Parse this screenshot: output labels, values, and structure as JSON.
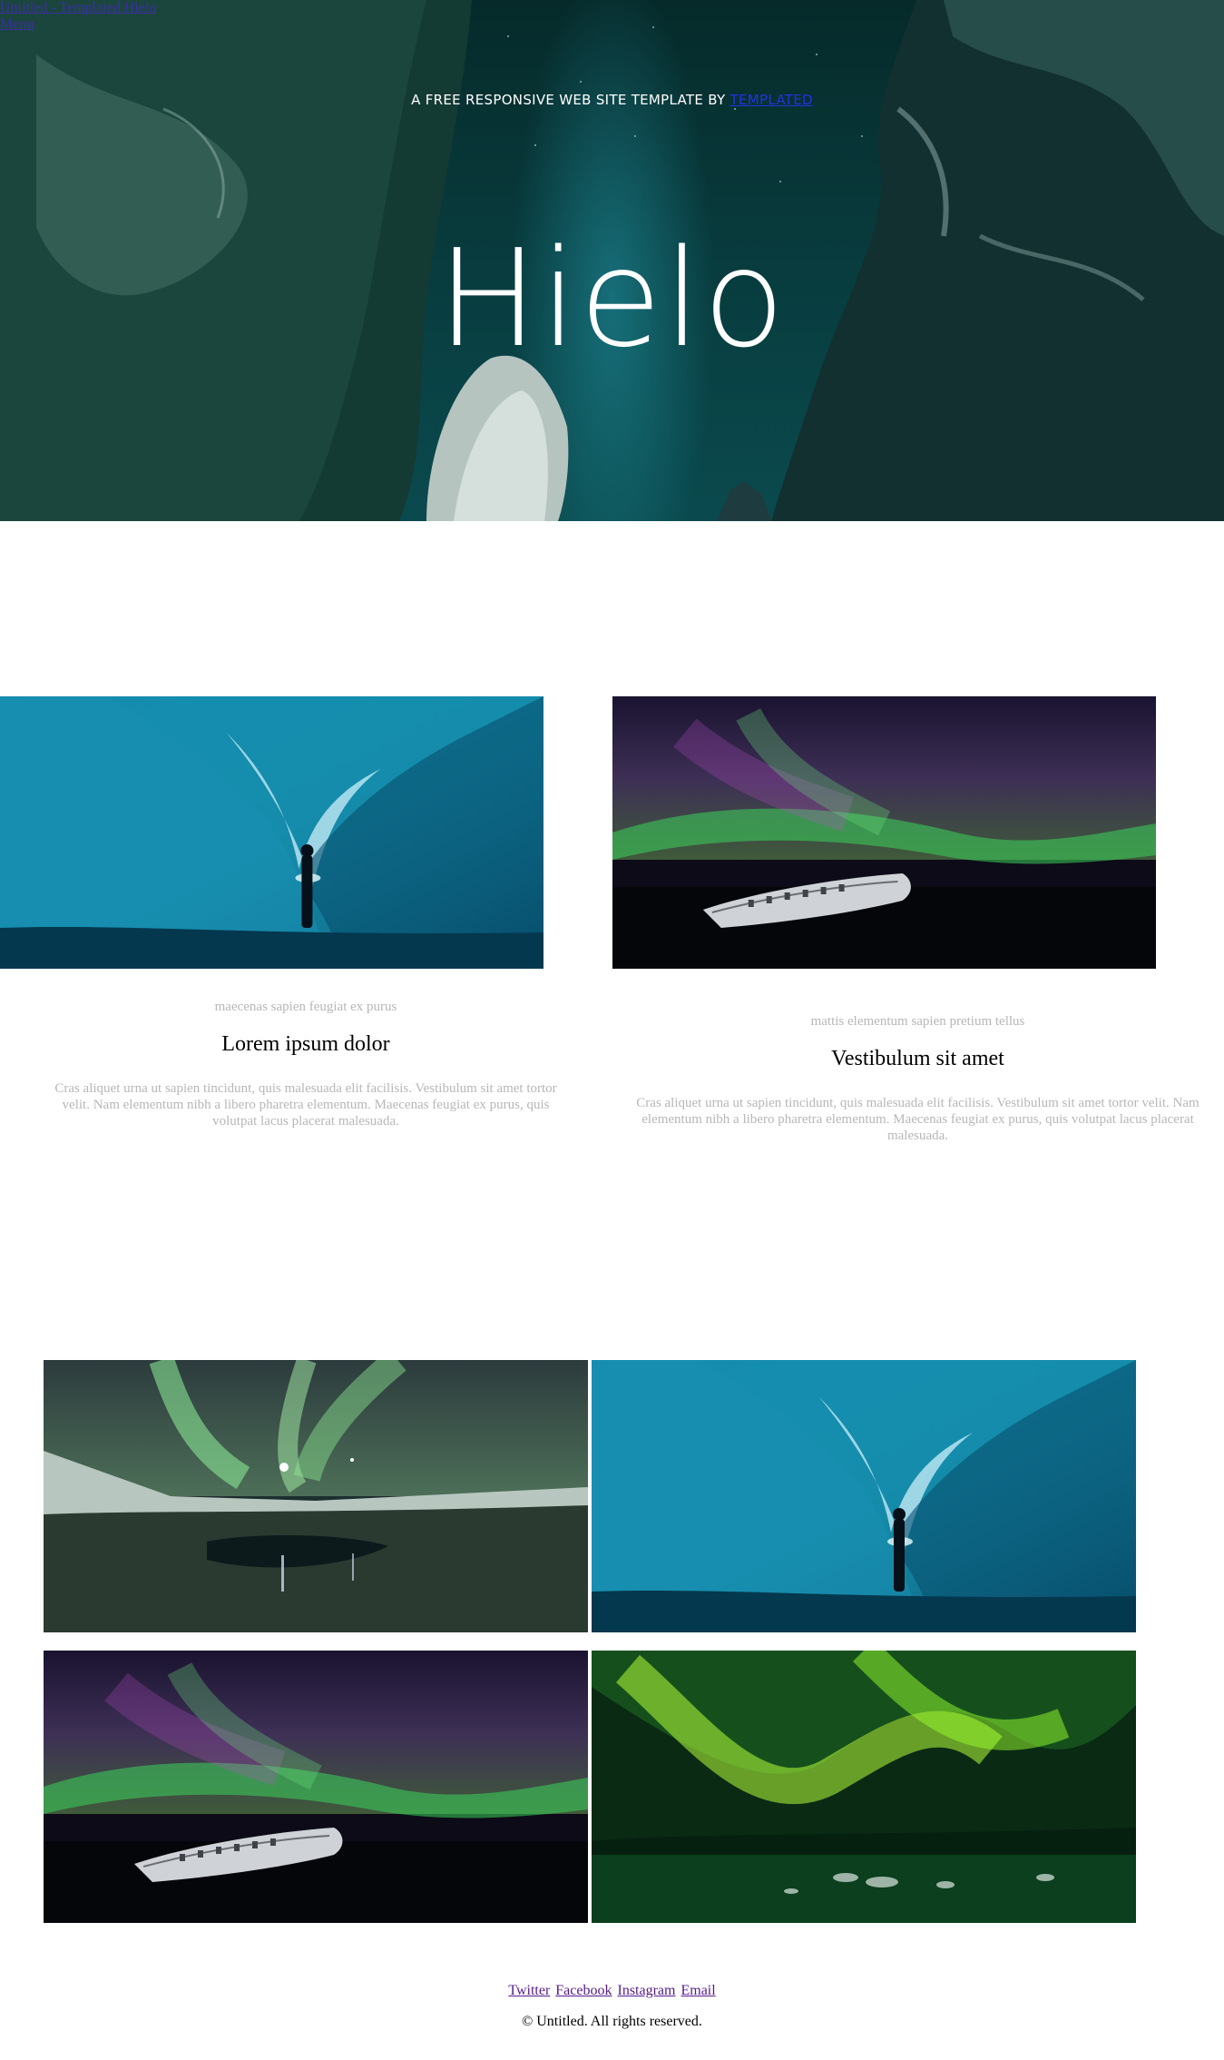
{
  "nav": {
    "home_link": "Untitled - Templated Hielo",
    "menu_link": "Menu"
  },
  "banner": {
    "tagline": "A FREE RESPONSIVE WEB SITE TEMPLATE BY",
    "tagline_link": "TEMPLATED",
    "title": "Hielo"
  },
  "articles": [
    {
      "subtitle": "maecenas sapien feugiat ex purus",
      "title": "Lorem ipsum dolor",
      "text": "Cras aliquet urna ut sapien tincidunt, quis malesuada elit facilisis. Vestibulum sit amet tortor velit. Nam elementum nibh a libero pharetra elementum. Maecenas feugiat ex purus, quis volutpat lacus placerat malesuada."
    },
    {
      "subtitle": "mattis elementum sapien pretium tellus",
      "title": "Vestibulum sit amet",
      "text": "Cras aliquet urna ut sapien tincidunt, quis malesuada elit facilisis. Vestibulum sit amet tortor velit. Nam elementum nibh a libero pharetra elementum. Maecenas feugiat ex purus, quis volutpat lacus placerat malesuada."
    }
  ],
  "gallery": {
    "images": [
      "aurora-lake-image",
      "ice-cave-image",
      "plane-wreck-aurora-image",
      "green-aurora-image"
    ]
  },
  "footer": {
    "links": [
      "Twitter",
      "Facebook",
      "Instagram",
      "Email"
    ],
    "copyright": "© Untitled. All rights reserved."
  }
}
